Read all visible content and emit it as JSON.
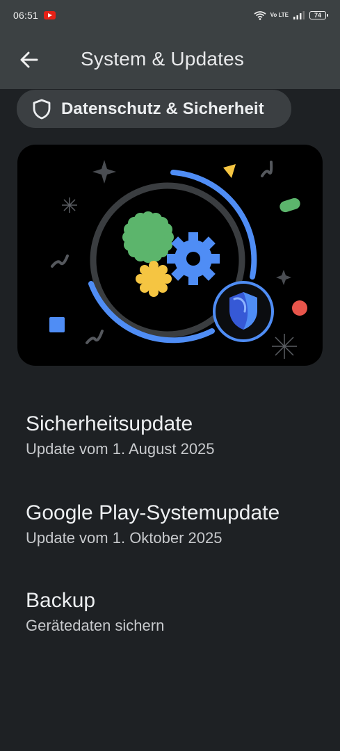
{
  "status_bar": {
    "time": "06:51",
    "network": "Vo LTE",
    "battery": "74"
  },
  "app_bar": {
    "title": "System & Updates",
    "back_icon": "arrow-back-icon"
  },
  "chip": {
    "label": "Datenschutz & Sicherheit",
    "icon": "shield-icon"
  },
  "colors": {
    "background": "#1e2124",
    "topbar": "#3c4143",
    "chip": "#3b3f42",
    "accent_blue": "#4f8df5",
    "green": "#5cb56c",
    "yellow": "#f5c542",
    "red": "#e8554b"
  },
  "items": [
    {
      "title": "Sicherheitsupdate",
      "subtitle": "Update vom 1. August 2025"
    },
    {
      "title": "Google Play-Systemupdate",
      "subtitle": "Update vom 1. Oktober 2025"
    },
    {
      "title": "Backup",
      "subtitle": "Gerätedaten sichern"
    }
  ]
}
